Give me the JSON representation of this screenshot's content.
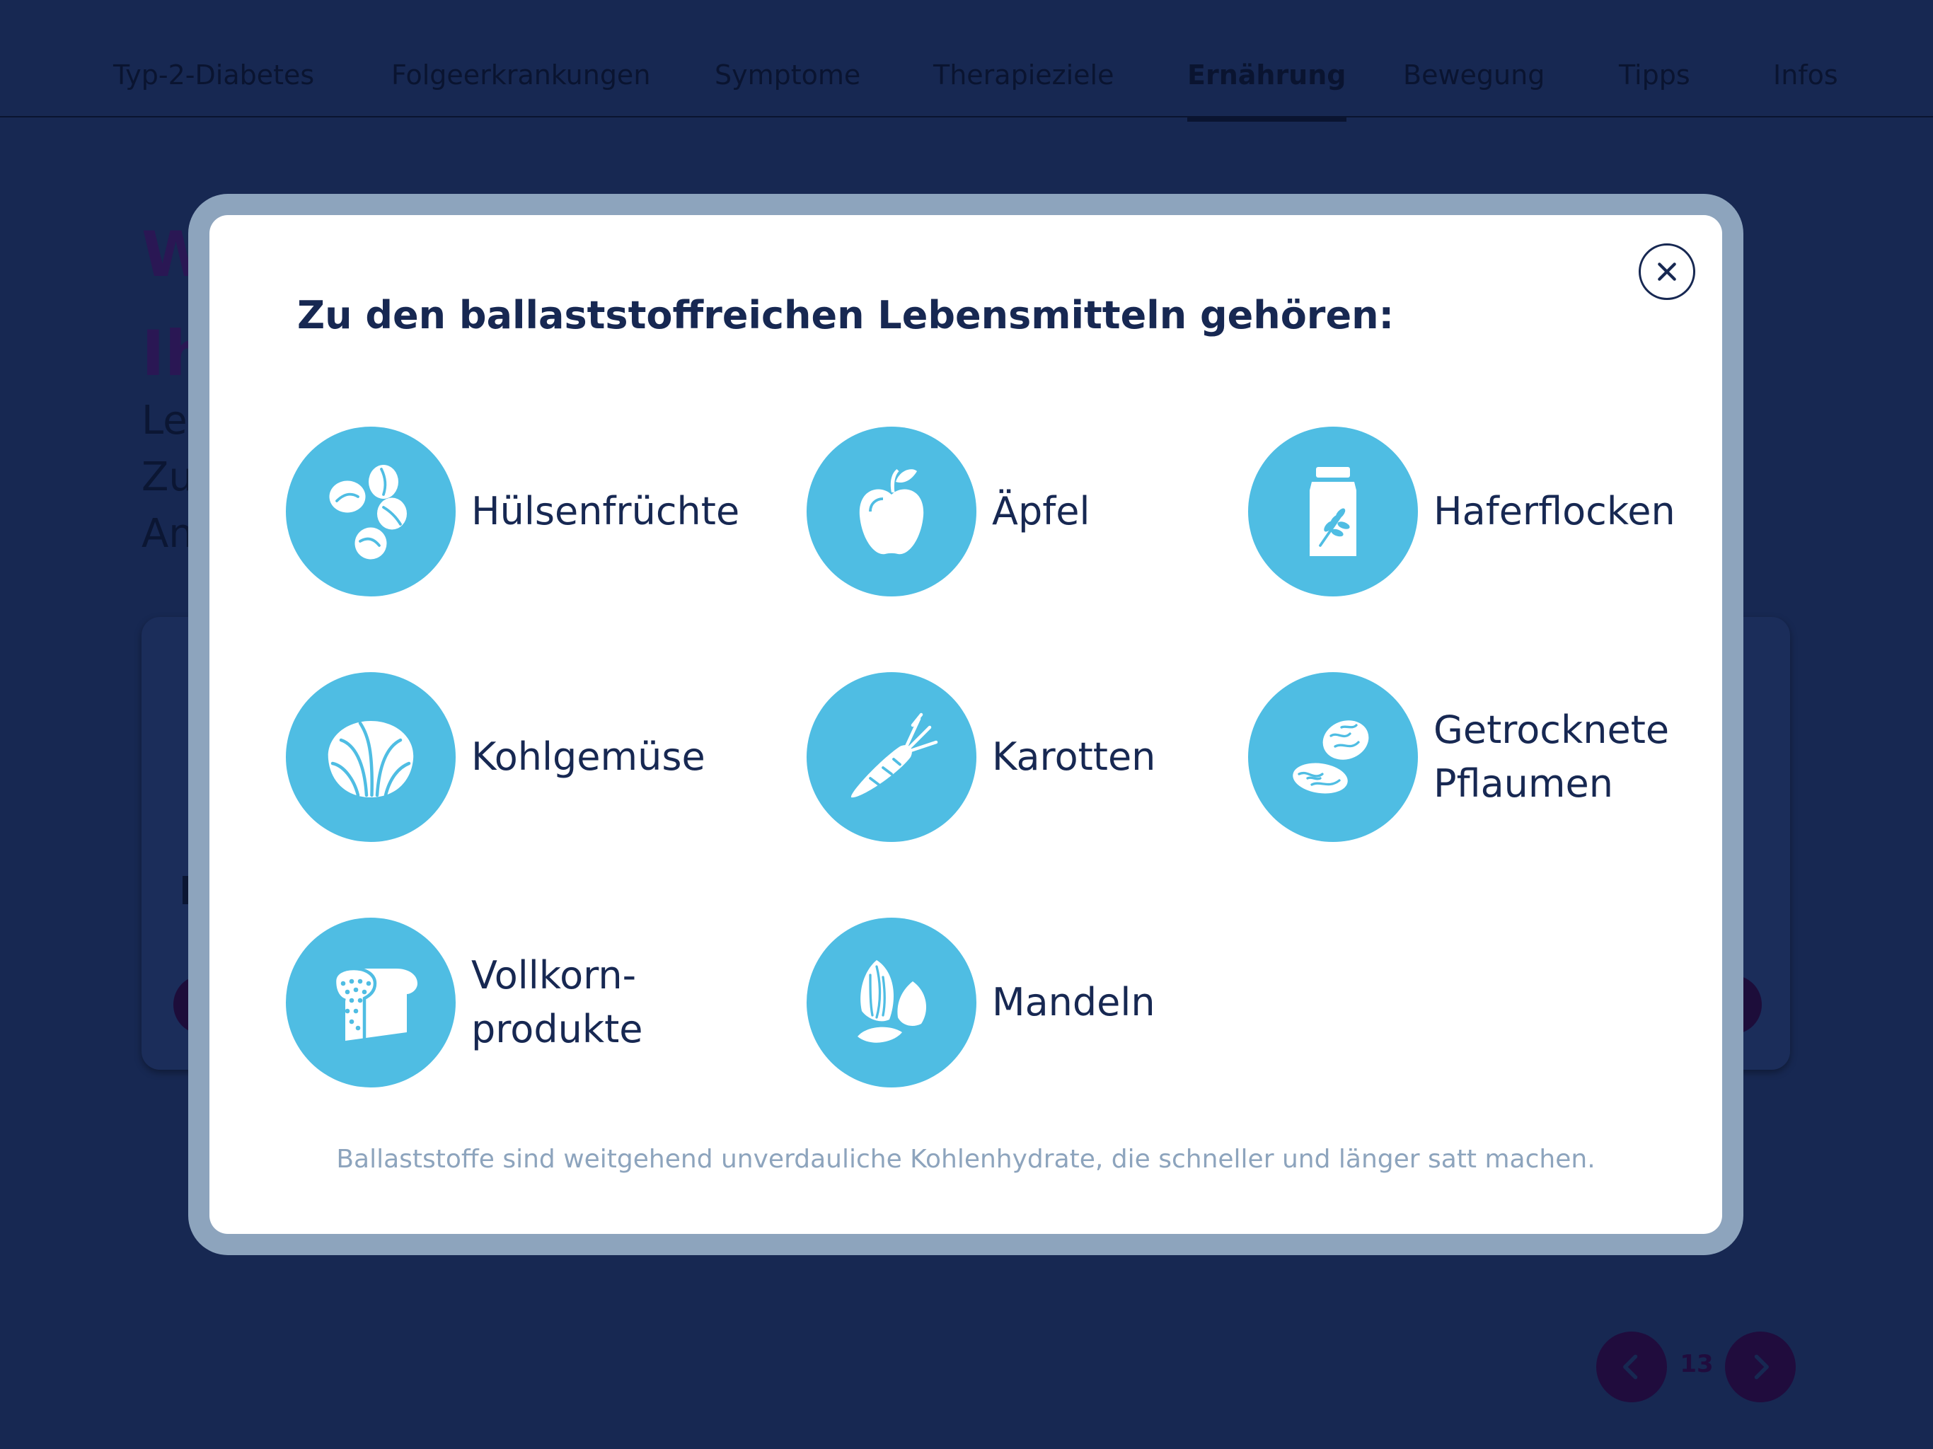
{
  "nav": {
    "items": [
      {
        "label": "Typ-2-Diabetes",
        "active": false
      },
      {
        "label": "Folgeerkrankungen",
        "active": false
      },
      {
        "label": "Symptome",
        "active": false
      },
      {
        "label": "Therapieziele",
        "active": false
      },
      {
        "label": "Ernährung",
        "active": true
      },
      {
        "label": "Bewegung",
        "active": false
      },
      {
        "label": "Tipps",
        "active": false
      },
      {
        "label": "Infos",
        "active": false
      }
    ]
  },
  "background": {
    "title_fragment": "W\nIh",
    "text_fragment": "Le\nZu\nAn"
  },
  "pager": {
    "page": "13"
  },
  "modal": {
    "heading": "Zu den ballaststoffreichen Lebensmitteln gehören:",
    "foods": [
      {
        "label": "Hülsenfrüchte",
        "icon": "legumes-icon"
      },
      {
        "label": "Äpfel",
        "icon": "apple-icon"
      },
      {
        "label": "Haferflocken",
        "icon": "oat-bag-icon"
      },
      {
        "label": "Kohlgemüse",
        "icon": "cabbage-icon"
      },
      {
        "label": "Karotten",
        "icon": "carrot-icon"
      },
      {
        "label": "Getrocknete\nPflaumen",
        "icon": "prunes-icon"
      },
      {
        "label": "Vollkorn-\nprodukte",
        "icon": "bread-icon"
      },
      {
        "label": "Mandeln",
        "icon": "almonds-icon"
      }
    ],
    "footnote": "Ballaststoffe sind weitgehend unverdauliche Kohlenhydrate, die schneller und länger satt machen."
  },
  "colors": {
    "overlay": "#172852",
    "frame": "#8da4bd",
    "icon_circle": "#4fbde3",
    "text": "#172852"
  }
}
